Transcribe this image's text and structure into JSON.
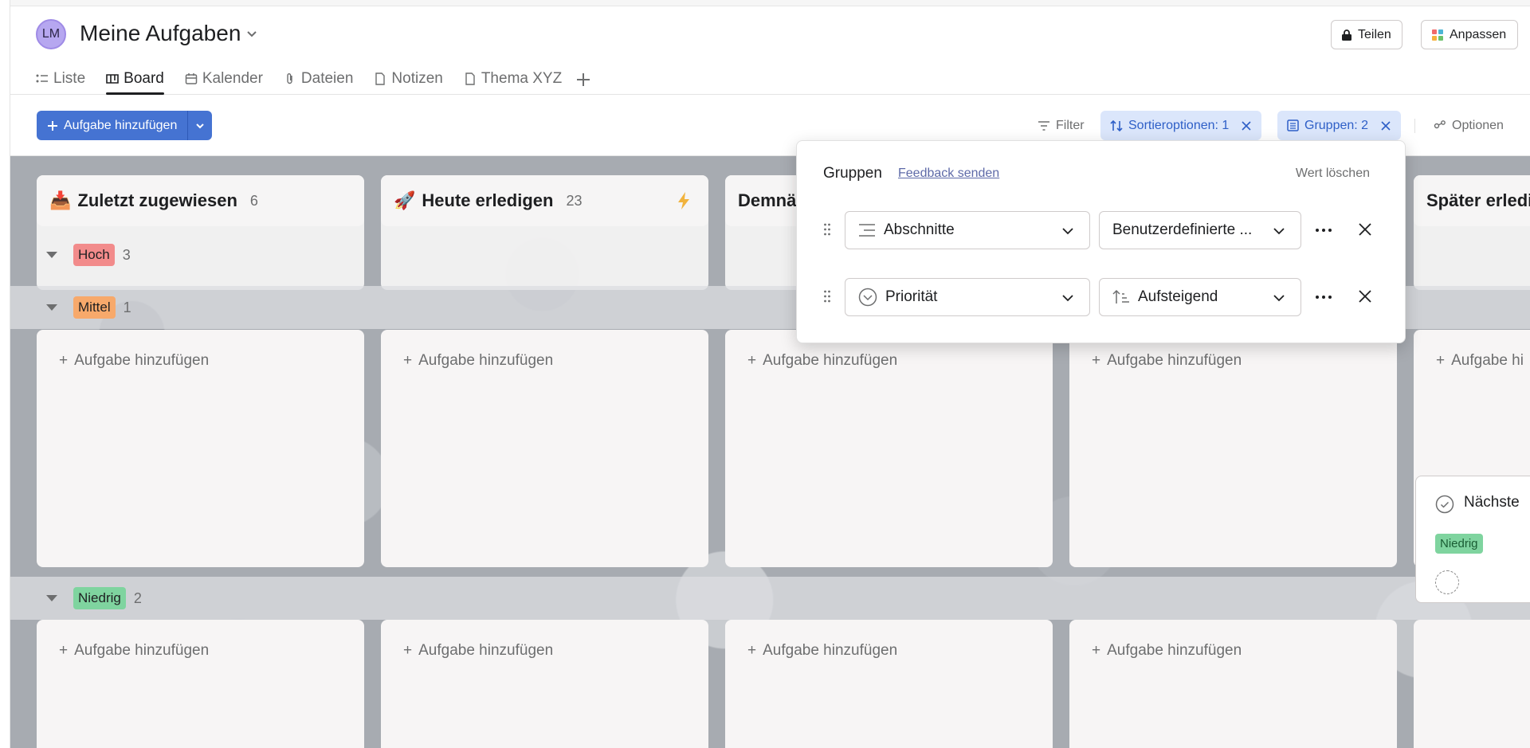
{
  "header": {
    "avatar_initials": "LM",
    "title": "Meine Aufgaben",
    "share_label": "Teilen",
    "customize_label": "Anpassen",
    "tabs": [
      {
        "label": "Liste",
        "icon": "list-icon"
      },
      {
        "label": "Board",
        "icon": "board-icon",
        "active": true
      },
      {
        "label": "Kalender",
        "icon": "calendar-icon"
      },
      {
        "label": "Dateien",
        "icon": "paperclip-icon"
      },
      {
        "label": "Notizen",
        "icon": "document-icon"
      },
      {
        "label": "Thema XYZ",
        "icon": "document-icon"
      }
    ]
  },
  "toolbar": {
    "add_task_label": "Aufgabe hinzufügen",
    "filter_label": "Filter",
    "sort_label": "Sortieroptionen: 1",
    "group_label": "Gruppen: 2",
    "options_label": "Optionen"
  },
  "columns": [
    {
      "emoji": "📥",
      "title": "Zuletzt zugewiesen",
      "count": "6"
    },
    {
      "emoji": "🚀",
      "title": "Heute erledigen",
      "count": "23"
    },
    {
      "title": "Demnä"
    },
    {
      "title": ""
    },
    {
      "title": "Später erledi"
    }
  ],
  "groups": [
    {
      "label": "Hoch",
      "count": "3",
      "color": "#f28b8b"
    },
    {
      "label": "Mittel",
      "count": "1",
      "color": "#f7a96b"
    },
    {
      "label": "Niedrig",
      "count": "2",
      "color": "#7fd49f"
    }
  ],
  "card_add_label": "Aufgabe hinzufügen",
  "card_add_label_cut": "Aufgabe hi",
  "task_card": {
    "name": "Nächste",
    "priority": "Niedrig"
  },
  "popover": {
    "title": "Gruppen",
    "feedback": "Feedback senden",
    "clear": "Wert löschen",
    "rows": [
      {
        "field": "Abschnitte",
        "order": "Benutzerdefinierte ..."
      },
      {
        "field": "Priorität",
        "order": "Aufsteigend"
      }
    ]
  }
}
